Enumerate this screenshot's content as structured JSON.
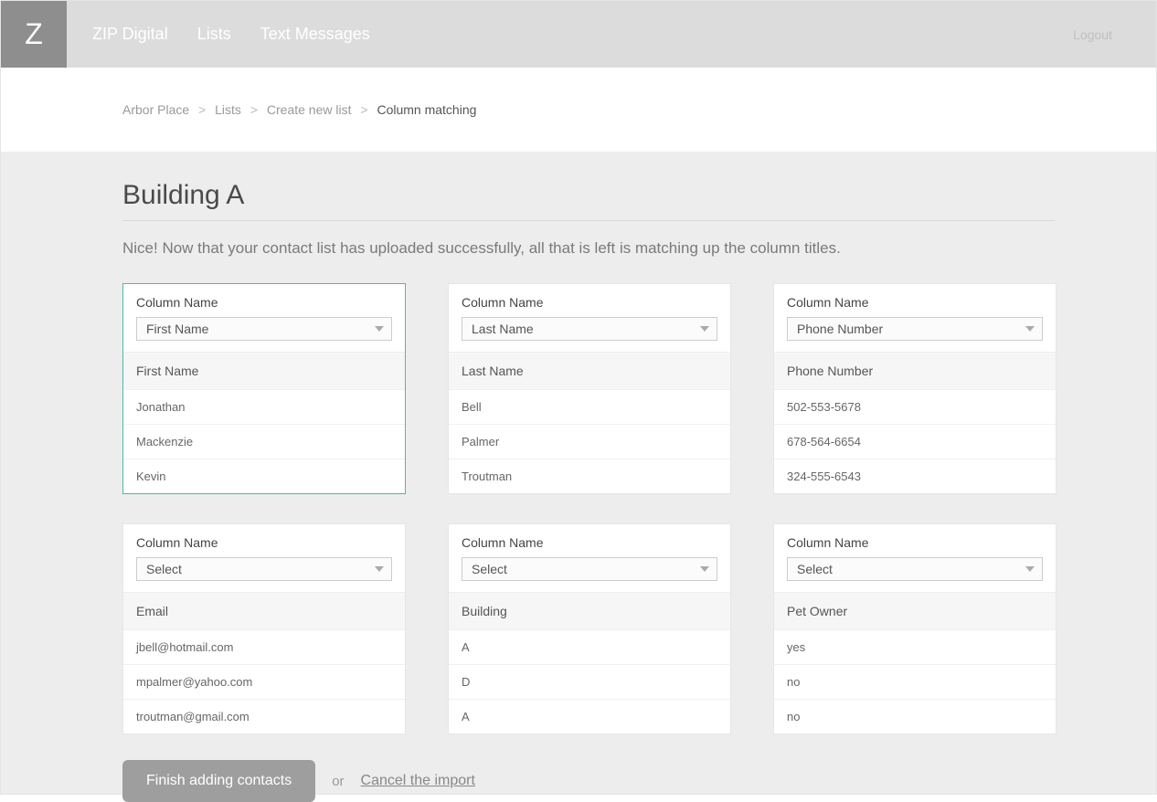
{
  "header": {
    "logo_letter": "Z",
    "brand": "ZIP Digital",
    "nav": {
      "lists": "Lists",
      "text_messages": "Text Messages"
    },
    "logout": "Logout"
  },
  "breadcrumb": {
    "item0": "Arbor Place",
    "item1": "Lists",
    "item2": "Create new list",
    "current": "Column matching",
    "sep": ">"
  },
  "page": {
    "title": "Building A",
    "subtitle": "Nice! Now that your contact list has uploaded successfully, all that is left is matching up the column titles."
  },
  "column_label": "Column Name",
  "cards": [
    {
      "selected": "First Name",
      "header": "First Name",
      "rows": [
        "Jonathan",
        "Mackenzie",
        "Kevin"
      ]
    },
    {
      "selected": "Last Name",
      "header": "Last Name",
      "rows": [
        "Bell",
        "Palmer",
        "Troutman"
      ]
    },
    {
      "selected": "Phone Number",
      "header": "Phone Number",
      "rows": [
        "502-553-5678",
        "678-564-6654",
        "324-555-6543"
      ]
    },
    {
      "selected": "Select",
      "header": "Email",
      "rows": [
        "jbell@hotmail.com",
        "mpalmer@yahoo.com",
        "troutman@gmail.com"
      ]
    },
    {
      "selected": "Select",
      "header": "Building",
      "rows": [
        "A",
        "D",
        "A"
      ]
    },
    {
      "selected": "Select",
      "header": "Pet Owner",
      "rows": [
        "yes",
        "no",
        "no"
      ]
    }
  ],
  "actions": {
    "finish": "Finish adding contacts",
    "or": "or",
    "cancel": "Cancel the import"
  }
}
